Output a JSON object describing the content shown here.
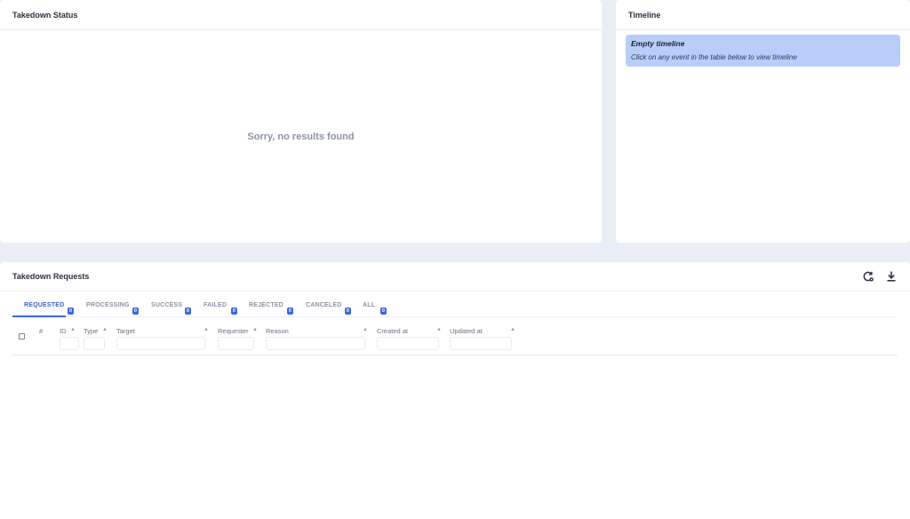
{
  "status_panel": {
    "title": "Takedown Status",
    "empty_message": "Sorry, no results found"
  },
  "timeline_panel": {
    "title": "Timeline",
    "empty_title": "Empty timeline",
    "empty_hint": "Click on any event in the table below to view timeline"
  },
  "requests_panel": {
    "title": "Takedown Requests",
    "icons": [
      "refresh-settings-icon",
      "download-icon"
    ],
    "tabs": [
      {
        "label": "REQUESTED",
        "count": "0",
        "active": true
      },
      {
        "label": "PROCESSING",
        "count": "0"
      },
      {
        "label": "SUCCESS",
        "count": "0"
      },
      {
        "label": "FAILED",
        "count": "0"
      },
      {
        "label": "REJECTED",
        "count": "0"
      },
      {
        "label": "CANCELED",
        "count": "0"
      },
      {
        "label": "ALL",
        "count": "0"
      }
    ],
    "columns": [
      "#",
      "ID",
      "Type",
      "Target",
      "Requester",
      "Reason",
      "Created at",
      "Updated at"
    ],
    "accent_color": "#3d67d6"
  }
}
